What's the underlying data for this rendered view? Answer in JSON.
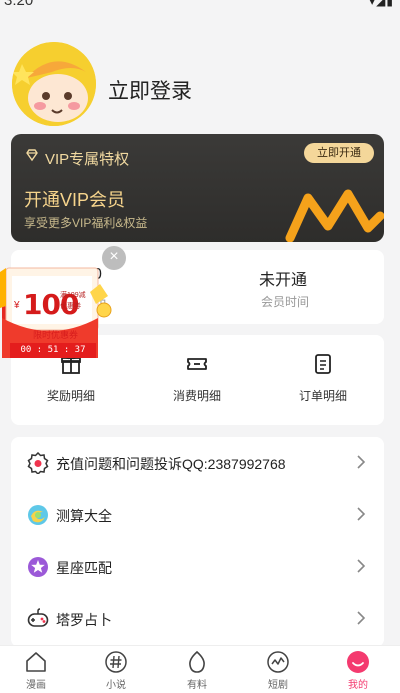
{
  "status": {
    "time": "3:20",
    "icons": "▾◢▮"
  },
  "header": {
    "login_label": "立即登录"
  },
  "vip": {
    "title": "VIP专属特权",
    "open_button": "立即开通",
    "headline": "开通VIP会员",
    "subtitle": "享受更多VIP福利&权益"
  },
  "stats": {
    "coins_value": "0",
    "coins_label": "币",
    "member_value": "未开通",
    "member_label": "会员时间"
  },
  "coupon": {
    "close": "×",
    "yen": "¥",
    "amount": "100",
    "condition": "满199减",
    "type": "优惠券",
    "limit_label": "限时优惠券",
    "timer": "00 : 51 : 37"
  },
  "actions": [
    {
      "label": "奖励明细",
      "icon": "gift-icon"
    },
    {
      "label": "消费明细",
      "icon": "ticket-icon"
    },
    {
      "label": "订单明细",
      "icon": "order-list-icon"
    }
  ],
  "menu": [
    {
      "label": "充值问题和问题投诉QQ:2387992768",
      "icon": "badge-icon"
    },
    {
      "label": "测算大全",
      "icon": "swirl-icon"
    },
    {
      "label": "星座匹配",
      "icon": "star-icon"
    },
    {
      "label": "塔罗占卜",
      "icon": "gamepad-icon"
    }
  ],
  "tabs": [
    {
      "label": "漫画",
      "icon": "home-icon"
    },
    {
      "label": "小说",
      "icon": "hash-icon"
    },
    {
      "label": "有料",
      "icon": "egg-icon"
    },
    {
      "label": "短剧",
      "icon": "pulse-icon"
    },
    {
      "label": "我的",
      "icon": "smile-icon"
    }
  ],
  "colors": {
    "accent": "#f43a6f",
    "vip_gold": "#f4d79a",
    "coupon_red": "#e41d1d"
  }
}
